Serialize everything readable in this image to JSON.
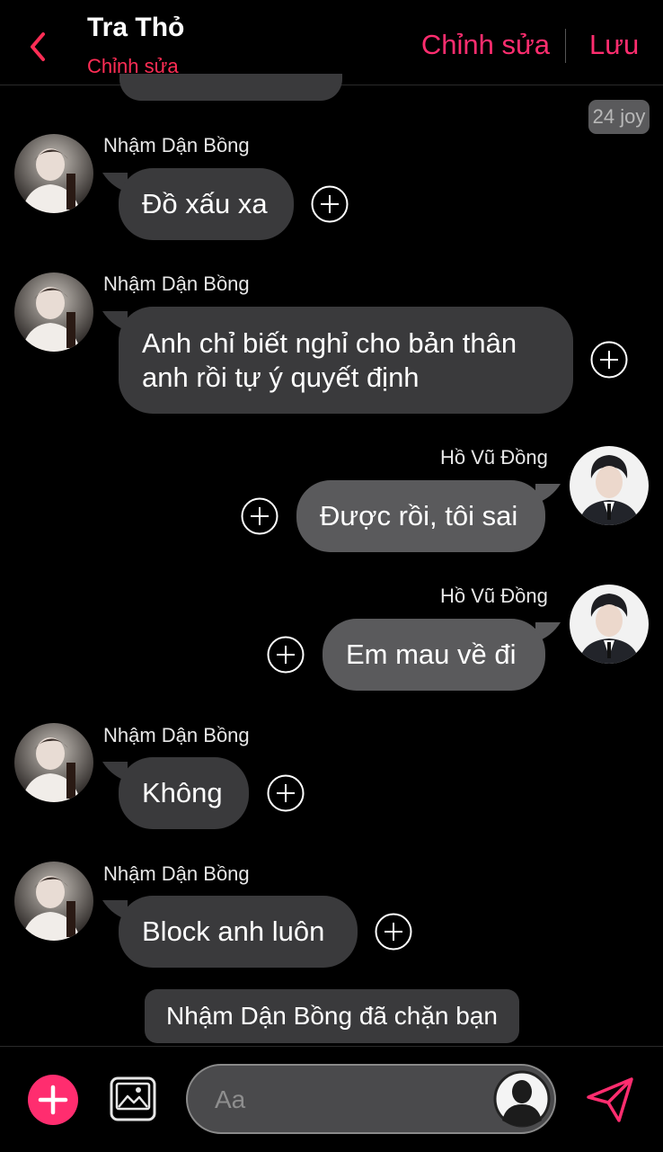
{
  "header": {
    "title": "Tra Thỏ",
    "subtitle": "Chỉnh sửa",
    "edit_label": "Chỉnh sửa",
    "save_label": "Lưu",
    "accent_color": "#ff2d6f"
  },
  "time_badge": "24 joy",
  "messages": [
    {
      "sender": "Nhậm Dận Bồng",
      "text": "Đồ xấu xa",
      "side": "left"
    },
    {
      "sender": "Nhậm Dận Bồng",
      "text_line1": "Anh chỉ biết nghỉ cho bản thân",
      "text_line2": "anh rồi tự ý quyết định",
      "side": "left"
    },
    {
      "sender": "Hồ Vũ Đồng",
      "text": "Được rồi, tôi sai",
      "side": "right"
    },
    {
      "sender": "Hồ Vũ Đồng",
      "text": "Em mau về đi",
      "side": "right"
    },
    {
      "sender": "Nhậm Dận Bồng",
      "text": "Không",
      "side": "left"
    },
    {
      "sender": "Nhậm Dận Bồng",
      "text": "Block anh luôn",
      "side": "left"
    }
  ],
  "notice": "Nhậm Dận Bồng đã chặn bạn",
  "composer": {
    "placeholder": "Aa",
    "icons": [
      "plus-icon",
      "image-icon",
      "user-silhouette-icon",
      "send-icon"
    ]
  }
}
